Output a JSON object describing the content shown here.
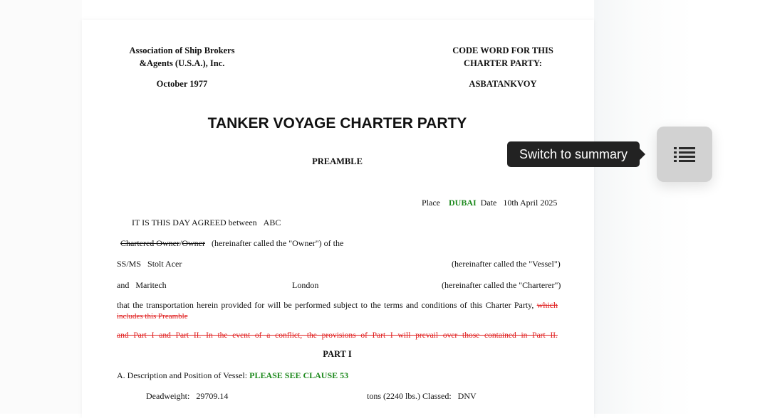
{
  "header": {
    "association_line1": "Association of Ship Brokers",
    "association_line2": "&Agents (U.S.A.), Inc.",
    "date": "October 1977",
    "code_word_line1": "CODE WORD FOR THIS",
    "code_word_line2": "CHARTER PARTY:",
    "code_word": "ASBATANKVOY"
  },
  "title": "TANKER VOYAGE CHARTER PARTY",
  "preamble_heading": "PREAMBLE",
  "place_label": "Place",
  "place_value": "DUBAI",
  "date_label": "Date",
  "date_value": "10th April 2025",
  "agreed_text": "IT IS THIS DAY AGREED between",
  "owner_name": "ABC",
  "owner_struck_1": "Chartered Owner",
  "owner_slash": "/",
  "owner_struck_2": "Owner",
  "owner_suffix": "(hereinafter called the \"Owner\") of the",
  "vessel_prefix": "SS/MS",
  "vessel_name": "Stolt Acer",
  "vessel_suffix": "(hereinafter called the \"Vessel\")",
  "charterer_prefix": "and",
  "charterer_name": "Maritech",
  "charterer_city": "London",
  "charterer_suffix": "(hereinafter called the \"Charterer\")",
  "transport_text": "that the transportation herein provided for will be performed subject to the terms and conditions of this Charter Party,",
  "transport_struck_1": "which",
  "transport_struck_2": "includes this Preamble",
  "parts_struck": "and Part I and Part II. In the event of a conflict, the provisions of Part I will prevail over those contained in Part II.",
  "part1_heading": "PART I",
  "clause_a_label": "A.   Description and Position of Vessel:",
  "clause_a_value": "PLEASE SEE CLAUSE 53",
  "deadweight_label": "Deadweight:",
  "deadweight_value": "29709.14",
  "tons_label": "tons (2240 lbs.) Classed:",
  "classed_value": "DNV",
  "tooltip": "Switch to summary",
  "icons": {
    "summary": "list-icon"
  },
  "colors": {
    "green": "#1e8a1e",
    "red": "#e02020",
    "tooltip_bg": "#222222",
    "button_bg": "#d2d2d2"
  }
}
